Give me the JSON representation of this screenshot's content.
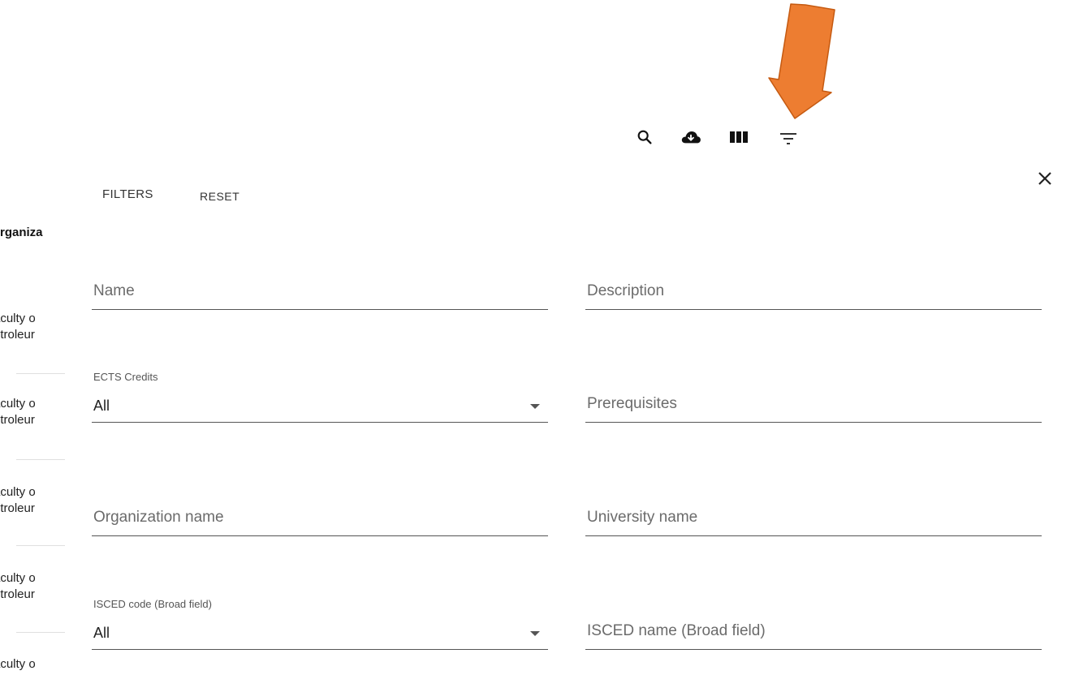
{
  "toolbar": {
    "icons": [
      "search-icon",
      "cloud-download-icon",
      "view-columns-icon",
      "filter-list-icon"
    ]
  },
  "background_table": {
    "header": "rganiza",
    "rows": [
      [
        "aculty o",
        "etroleur"
      ],
      [
        "aculty o",
        "etroleur"
      ],
      [
        "aculty o",
        "etroleur"
      ],
      [
        "aculty o",
        "etroleur"
      ],
      [
        "aculty o"
      ]
    ]
  },
  "filter_panel": {
    "title": "FILTERS",
    "reset_label": "RESET",
    "fields": {
      "name": {
        "placeholder": "Name"
      },
      "description": {
        "placeholder": "Description"
      },
      "ects": {
        "label": "ECTS Credits",
        "value": "All"
      },
      "prerequisites": {
        "placeholder": "Prerequisites"
      },
      "organization_name": {
        "placeholder": "Organization name"
      },
      "university_name": {
        "placeholder": "University name"
      },
      "isced_code": {
        "label": "ISCED code (Broad field)",
        "value": "All"
      },
      "isced_name": {
        "placeholder": "ISCED name (Broad field)"
      }
    }
  },
  "colors": {
    "annotation_arrow": "#ED7D31",
    "annotation_arrow_border": "#C55A11"
  }
}
